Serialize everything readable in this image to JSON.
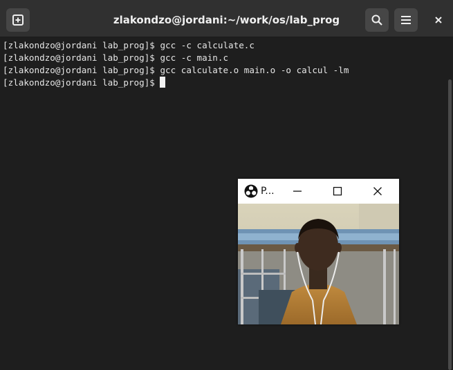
{
  "window": {
    "title": "zlakondzo@jordani:~/work/os/lab_prog",
    "new_tab_icon": "new-tab-icon",
    "search_icon": "search-icon",
    "menu_icon": "hamburger-menu-icon",
    "close_icon": "close-icon"
  },
  "terminal": {
    "lines": [
      "[zlakondzo@jordani lab_prog]$ gcc -c calculate.c",
      "[zlakondzo@jordani lab_prog]$ gcc -c main.c",
      "[zlakondzo@jordani lab_prog]$ gcc calculate.o main.o -o calcul -lm",
      "[zlakondzo@jordani lab_prog]$ "
    ]
  },
  "popup": {
    "title": "P...",
    "app_icon": "obs-logo-icon",
    "minimize_icon": "minimize-icon",
    "maximize_icon": "maximize-icon",
    "close_icon": "close-icon",
    "content": "webcam-preview"
  },
  "colors": {
    "titlebar": "#303030",
    "terminal_bg": "#1e1e1e",
    "terminal_fg": "#e6e6e6"
  }
}
